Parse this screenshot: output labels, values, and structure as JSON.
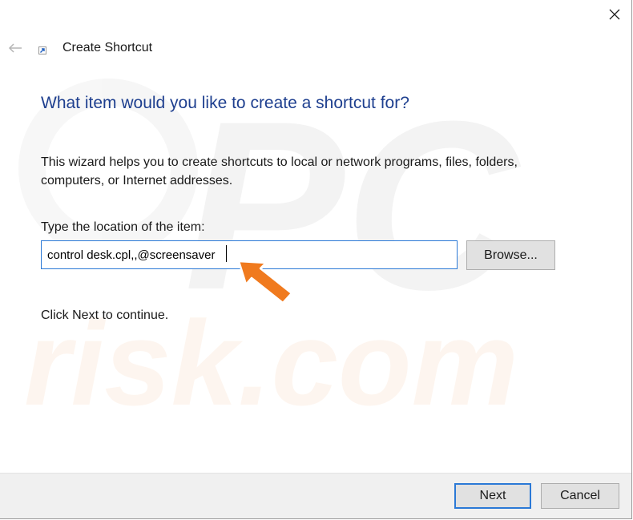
{
  "window": {
    "title": "Create Shortcut",
    "close_icon": "close-icon",
    "back_icon": "back-arrow-icon",
    "app_icon": "shortcut-icon"
  },
  "main": {
    "heading": "What item would you like to create a shortcut for?",
    "description": "This wizard helps you to create shortcuts to local or network programs, files, folders, computers, or Internet addresses.",
    "location_label": "Type the location of the item:",
    "location_value": "control desk.cpl,,@screensaver",
    "browse_label": "Browse...",
    "hint": "Click Next to continue."
  },
  "footer": {
    "next_label": "Next",
    "cancel_label": "Cancel"
  },
  "colors": {
    "heading": "#1e3f8f",
    "focus_border": "#2b79d6",
    "button_face": "#e1e1e1",
    "footer_bg": "#f0f0f0",
    "annotation_arrow": "#f07a1e"
  },
  "watermark": {
    "top_text": "PC",
    "bottom_text": "risk.com"
  }
}
